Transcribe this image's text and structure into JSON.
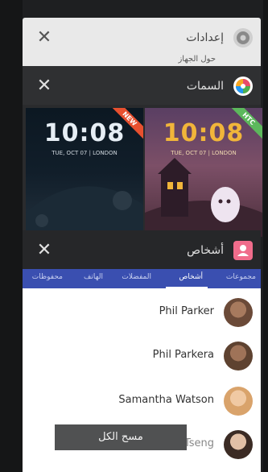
{
  "recent_cards": {
    "settings": {
      "title": "إعدادات",
      "subtitle": "حول الجهاز"
    },
    "themes": {
      "title": "السمات"
    },
    "people": {
      "title": "أشخاص"
    }
  },
  "themes_preview": {
    "left": {
      "time": "10:08",
      "date": "TUE, OCT 07 | LONDON",
      "badge": "NEW"
    },
    "right": {
      "time": "10:08",
      "date": "TUE, OCT 07 | LONDON",
      "badge": "HTC"
    }
  },
  "people_tabs": [
    "مجموعات",
    "أشخاص",
    "المفضلات",
    "الهاتف",
    "محفوظات"
  ],
  "active_tab_index": 1,
  "contacts": [
    {
      "name": "Phil Parker",
      "avatar_color": "#6b4a38"
    },
    {
      "name": "Phil Parkera",
      "avatar_color": "#5e4230"
    },
    {
      "name": "Samantha Watson",
      "avatar_color": "#d9a36b"
    },
    {
      "name": "Sofia Tseng",
      "avatar_color": "#3b2b24"
    }
  ],
  "toast": {
    "label": "مسح الكل"
  },
  "colors": {
    "tabs_bg": "#3a4fb0",
    "dark_header": "#2f3032",
    "themes_icon": "#f5a623"
  }
}
